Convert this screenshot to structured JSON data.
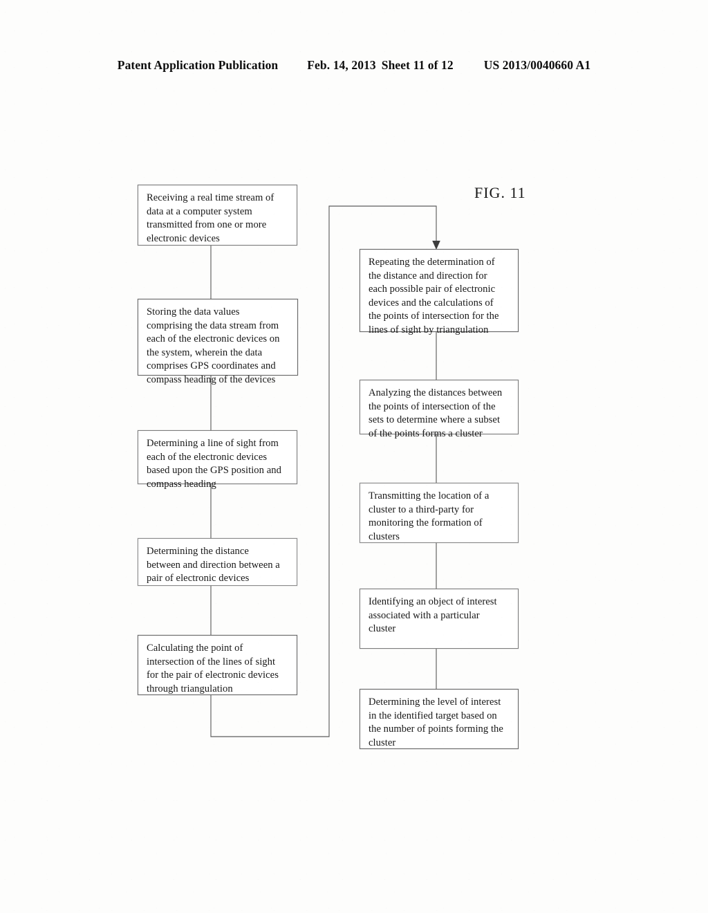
{
  "header": {
    "publication": "Patent Application Publication",
    "date": "Feb. 14, 2013",
    "sheet": "Sheet 11 of 12",
    "patent_number": "US 2013/0040660 A1"
  },
  "figure": {
    "label": "FIG. 11"
  },
  "colors": {
    "ink": "#171717",
    "box_border": "#6f6f6f",
    "paper": "#fdfdfc"
  },
  "flowchart": {
    "left_column": [
      {
        "id": "receive-stream",
        "text": "Receiving a real time stream of\ndata at a computer system\ntransmitted from one or more\nelectronic devices"
      },
      {
        "id": "store-data",
        "text": "Storing the data values\ncomprising the data stream from\neach of the electronic devices on\nthe system, wherein the data\ncomprises GPS coordinates and\ncompass heading of the devices"
      },
      {
        "id": "determine-line-of-sight",
        "text": "Determining a line of sight from\neach of the electronic devices\nbased upon the GPS position and\ncompass heading"
      },
      {
        "id": "determine-distance-direction",
        "text": "Determining the distance\nbetween and direction between a\npair of electronic devices"
      },
      {
        "id": "calculate-intersection",
        "text": "Calculating the point of\nintersection of the lines of sight\nfor the pair of electronic devices\nthrough triangulation"
      }
    ],
    "right_column": [
      {
        "id": "repeat-determination",
        "text": "Repeating the determination of\nthe distance and direction for\neach possible pair of electronic\ndevices and the calculations of\nthe points of intersection for the\nlines of sight by triangulation"
      },
      {
        "id": "analyze-distances",
        "text": "Analyzing the distances between\nthe points of intersection of the\nsets to determine where a subset\nof the points forms a cluster"
      },
      {
        "id": "transmit-cluster-location",
        "text": "Transmitting the location of a\ncluster to a third-party for\nmonitoring the formation of\nclusters"
      },
      {
        "id": "identify-object",
        "text": "Identifying an object of interest\nassociated with a particular\ncluster"
      },
      {
        "id": "determine-level-of-interest",
        "text": "Determining the level of interest\nin the identified target based on\nthe number of points forming the\ncluster"
      }
    ]
  }
}
